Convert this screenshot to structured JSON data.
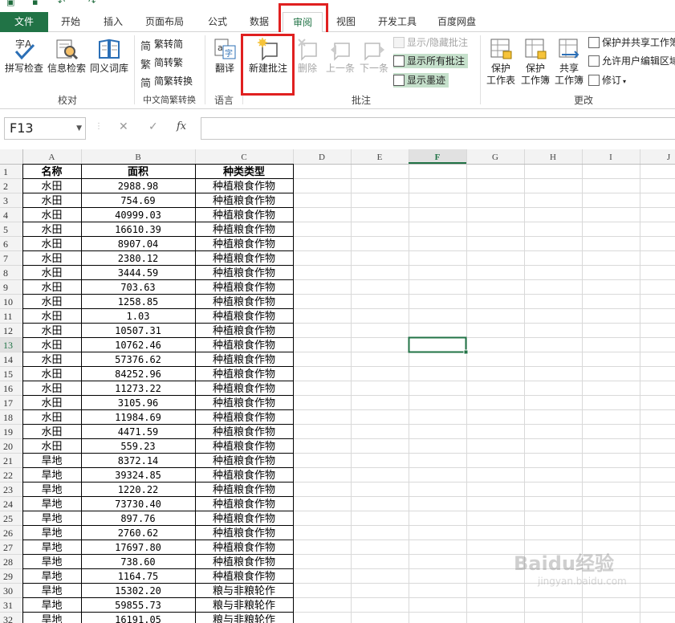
{
  "quick_access": {
    "icons": [
      "excel-logo",
      "save-icon",
      "undo-icon",
      "redo-icon"
    ]
  },
  "tabs": [
    {
      "label": "文件",
      "kind": "file"
    },
    {
      "label": "开始",
      "kind": "normal"
    },
    {
      "label": "插入",
      "kind": "normal"
    },
    {
      "label": "页面布局",
      "kind": "normal"
    },
    {
      "label": "公式",
      "kind": "normal"
    },
    {
      "label": "数据",
      "kind": "normal"
    },
    {
      "label": "审阅",
      "kind": "active"
    },
    {
      "label": "视图",
      "kind": "normal"
    },
    {
      "label": "开发工具",
      "kind": "normal"
    },
    {
      "label": "百度网盘",
      "kind": "normal"
    }
  ],
  "ribbon": {
    "proofing": {
      "group": "校对",
      "spell_check": "拼写检查",
      "research": "信息检索",
      "thesaurus": "同义词库"
    },
    "chinese_conv": {
      "group": "中文简繁转换",
      "to_simplified": "繁转简",
      "to_traditional": "简转繁",
      "conversion": "简繁转换"
    },
    "language": {
      "group": "语言",
      "translate": "翻译"
    },
    "comments": {
      "group": "批注",
      "new_comment": "新建批注",
      "delete": "删除",
      "previous": "上一条",
      "next": "下一条",
      "show_hide": "显示/隐藏批注",
      "show_all": "显示所有批注",
      "show_ink": "显示墨迹"
    },
    "changes": {
      "group": "更改",
      "protect_sheet": [
        "保护",
        "工作表"
      ],
      "protect_workbook": [
        "保护",
        "工作簿"
      ],
      "share_workbook": [
        "共享",
        "工作簿"
      ],
      "protect_share": "保护并共享工作簿",
      "allow_edit": "允许用户编辑区域",
      "track": "修订"
    }
  },
  "formula_bar": {
    "name_box": "F13",
    "fx_label": "fx",
    "cancel_icon": "x-icon",
    "enter_icon": "check-icon",
    "formula": ""
  },
  "sheet": {
    "columns": [
      "A",
      "B",
      "C",
      "D",
      "E",
      "F",
      "G",
      "H",
      "I",
      "J"
    ],
    "active_cell": "F13",
    "header": [
      "名称",
      "面积",
      "种类类型"
    ],
    "rows": [
      [
        "水田",
        "2988.98",
        "种植粮食作物"
      ],
      [
        "水田",
        "754.69",
        "种植粮食作物"
      ],
      [
        "水田",
        "40999.03",
        "种植粮食作物"
      ],
      [
        "水田",
        "16610.39",
        "种植粮食作物"
      ],
      [
        "水田",
        "8907.04",
        "种植粮食作物"
      ],
      [
        "水田",
        "2380.12",
        "种植粮食作物"
      ],
      [
        "水田",
        "3444.59",
        "种植粮食作物"
      ],
      [
        "水田",
        "703.63",
        "种植粮食作物"
      ],
      [
        "水田",
        "1258.85",
        "种植粮食作物"
      ],
      [
        "水田",
        "1.03",
        "种植粮食作物"
      ],
      [
        "水田",
        "10507.31",
        "种植粮食作物"
      ],
      [
        "水田",
        "10762.46",
        "种植粮食作物"
      ],
      [
        "水田",
        "57376.62",
        "种植粮食作物"
      ],
      [
        "水田",
        "84252.96",
        "种植粮食作物"
      ],
      [
        "水田",
        "11273.22",
        "种植粮食作物"
      ],
      [
        "水田",
        "3105.96",
        "种植粮食作物"
      ],
      [
        "水田",
        "11984.69",
        "种植粮食作物"
      ],
      [
        "水田",
        "4471.59",
        "种植粮食作物"
      ],
      [
        "水田",
        "559.23",
        "种植粮食作物"
      ],
      [
        "旱地",
        "8372.14",
        "种植粮食作物"
      ],
      [
        "旱地",
        "39324.85",
        "种植粮食作物"
      ],
      [
        "旱地",
        "1220.22",
        "种植粮食作物"
      ],
      [
        "旱地",
        "73730.40",
        "种植粮食作物"
      ],
      [
        "旱地",
        "897.76",
        "种植粮食作物"
      ],
      [
        "旱地",
        "2760.62",
        "种植粮食作物"
      ],
      [
        "旱地",
        "17697.80",
        "种植粮食作物"
      ],
      [
        "旱地",
        "738.60",
        "种植粮食作物"
      ],
      [
        "旱地",
        "1164.75",
        "种植粮食作物"
      ],
      [
        "旱地",
        "15302.20",
        "粮与非粮轮作"
      ],
      [
        "旱地",
        "59855.73",
        "粮与非粮轮作"
      ],
      [
        "旱地",
        "16191.05",
        "粮与非粮轮作"
      ]
    ]
  },
  "watermark": {
    "brand": "Baidu经验",
    "url": "jingyan.baidu.com"
  },
  "colors": {
    "accent": "#217346",
    "highlight": "#e02020",
    "selected": "#c5e0cb"
  }
}
